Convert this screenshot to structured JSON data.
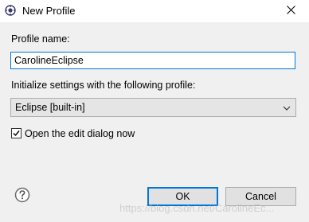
{
  "window": {
    "title": "New Profile",
    "close_glyph": "✕",
    "app_icon": "eclipse-formatter-icon"
  },
  "form": {
    "profile_name_label": "Profile name:",
    "profile_name_value": "CarolineEclipse",
    "init_label": "Initialize settings with the following profile:",
    "init_selected": "Eclipse [built-in]",
    "open_edit_label": "Open the edit dialog now",
    "open_edit_checked": true
  },
  "buttons": {
    "ok_label": "OK",
    "cancel_label": "Cancel",
    "help_icon": "help-icon"
  },
  "watermark": {
    "text": "https://blog.csdn.net/CarolineEc..."
  },
  "colors": {
    "accent": "#0078d7",
    "dialog_bg": "#f0f0f0",
    "button_bg": "#e1e1e1"
  }
}
